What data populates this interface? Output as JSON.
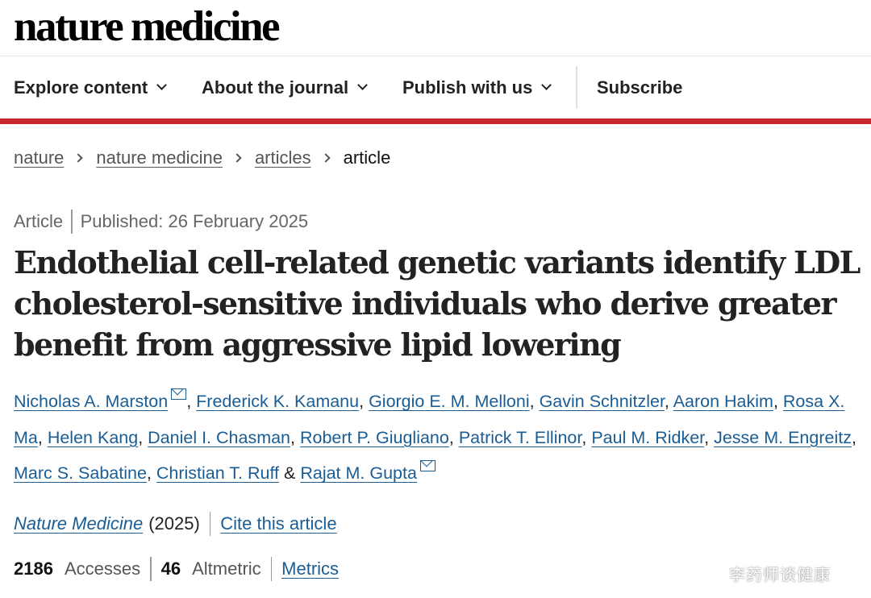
{
  "brand": {
    "name": "nature medicine"
  },
  "nav": {
    "items": [
      {
        "label": "Explore content"
      },
      {
        "label": "About the journal"
      },
      {
        "label": "Publish with us"
      }
    ],
    "subscribe": "Subscribe"
  },
  "colors": {
    "accent_bar": "#c6282d",
    "link": "#1a5d95"
  },
  "breadcrumb": [
    "nature",
    "nature medicine",
    "articles",
    "article"
  ],
  "article": {
    "type": "Article",
    "published": "Published: 26 February 2025",
    "title": "Endothelial cell-related genetic variants identify LDL cholesterol-sensitive individuals who derive greater benefit from aggressive lipid lowering",
    "authors": [
      "Nicholas A. Marston",
      "Frederick K. Kamanu",
      "Giorgio E. M. Melloni",
      "Gavin Schnitzler",
      "Aaron Hakim",
      "Rosa X. Ma",
      "Helen Kang",
      "Daniel I. Chasman",
      "Robert P. Giugliano",
      "Patrick T. Ellinor",
      "Paul M. Ridker",
      "Jesse M. Engreitz",
      "Marc S. Sabatine",
      "Christian T. Ruff",
      "Rajat M. Gupta"
    ],
    "journal": "Nature Medicine",
    "year": "(2025)",
    "cite_label": "Cite this article"
  },
  "metrics": {
    "accesses_count": "2186",
    "accesses_label": "Accesses",
    "altmetric_count": "46",
    "altmetric_label": "Altmetric",
    "metrics_link": "Metrics"
  },
  "icons": {
    "mail": "mail-icon",
    "chevron": "chevron-down-icon",
    "breadcrumb_sep": "chevron-right-icon"
  },
  "watermark": "李药师谈健康"
}
